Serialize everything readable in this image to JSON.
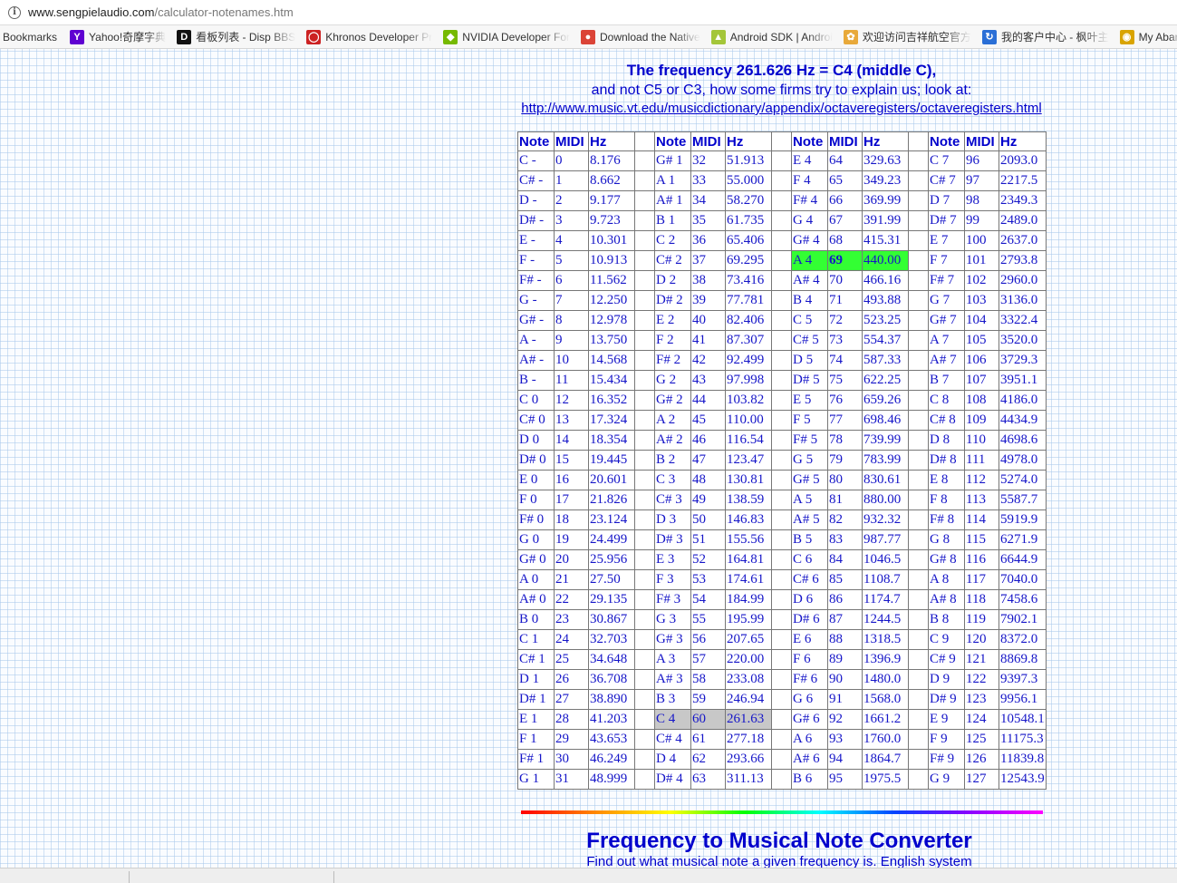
{
  "browser": {
    "url_domain": "www.sengpielaudio.com",
    "url_path": "/calculator-notenames.htm",
    "bookmarks_label": "Bookmarks",
    "bookmarks": [
      {
        "label": "Yahoo!奇摩字典",
        "icon": "yahoo-icon",
        "glyph": "Y",
        "color": "#5f01d1"
      },
      {
        "label": "看板列表 - Disp BBS",
        "icon": "disp-bbs-icon",
        "glyph": "D",
        "color": "#111111"
      },
      {
        "label": "Khronos Developer Pr",
        "icon": "khronos-icon",
        "glyph": "◯",
        "color": "#cc2222"
      },
      {
        "label": "NVIDIA Developer For",
        "icon": "nvidia-icon",
        "glyph": "◆",
        "color": "#76b900"
      },
      {
        "label": "Download the Native",
        "icon": "chrome-icon",
        "glyph": "●",
        "color": "#db4437"
      },
      {
        "label": "Android SDK | Androi",
        "icon": "android-icon",
        "glyph": "▲",
        "color": "#a4c639"
      },
      {
        "label": "欢迎访问吉祥航空官方",
        "icon": "juneyao-icon",
        "glyph": "✿",
        "color": "#e8a93a"
      },
      {
        "label": "我的客户中心 - 枫叶主",
        "icon": "refresh-icon",
        "glyph": "↻",
        "color": "#2b6fd6"
      },
      {
        "label": "My Aban",
        "icon": "aban-icon",
        "glyph": "◉",
        "color": "#d9a400"
      }
    ]
  },
  "page": {
    "headline": "The frequency 261.626 Hz = C4 (middle C),",
    "subline": "and not C5 or C3, how some firms try to explain us; look at:",
    "link": "http://www.music.vt.edu/musicdictionary/appendix/octaveregisters/octaveregisters.html",
    "converter_title": "Frequency to Musical Note Converter",
    "converter_subtitle": "Find out what musical note a given frequency is. English system"
  },
  "note_table": {
    "headers": [
      "Note",
      "MIDI",
      "Hz"
    ],
    "highlight_colors": {
      "a4": "#33ff33",
      "c4": "#c8c8c8"
    },
    "columns": [
      [
        [
          "C -",
          "0",
          "8.176"
        ],
        [
          "C# -",
          "1",
          "8.662"
        ],
        [
          "D -",
          "2",
          "9.177"
        ],
        [
          "D# -",
          "3",
          "9.723"
        ],
        [
          "E -",
          "4",
          "10.301"
        ],
        [
          "F -",
          "5",
          "10.913"
        ],
        [
          "F# -",
          "6",
          "11.562"
        ],
        [
          "G -",
          "7",
          "12.250"
        ],
        [
          "G# -",
          "8",
          "12.978"
        ],
        [
          "A -",
          "9",
          "13.750"
        ],
        [
          "A# -",
          "10",
          "14.568"
        ],
        [
          "B -",
          "11",
          "15.434"
        ],
        [
          "C 0",
          "12",
          "16.352"
        ],
        [
          "C# 0",
          "13",
          "17.324"
        ],
        [
          "D 0",
          "14",
          "18.354"
        ],
        [
          "D# 0",
          "15",
          "19.445"
        ],
        [
          "E 0",
          "16",
          "20.601"
        ],
        [
          "F 0",
          "17",
          "21.826"
        ],
        [
          "F# 0",
          "18",
          "23.124"
        ],
        [
          "G 0",
          "19",
          "24.499"
        ],
        [
          "G# 0",
          "20",
          "25.956"
        ],
        [
          "A 0",
          "21",
          "27.50"
        ],
        [
          "A# 0",
          "22",
          "29.135"
        ],
        [
          "B 0",
          "23",
          "30.867"
        ],
        [
          "C 1",
          "24",
          "32.703"
        ],
        [
          "C# 1",
          "25",
          "34.648"
        ],
        [
          "D 1",
          "26",
          "36.708"
        ],
        [
          "D# 1",
          "27",
          "38.890"
        ],
        [
          "E 1",
          "28",
          "41.203"
        ],
        [
          "F 1",
          "29",
          "43.653"
        ],
        [
          "F# 1",
          "30",
          "46.249"
        ],
        [
          "G 1",
          "31",
          "48.999"
        ]
      ],
      [
        [
          "G# 1",
          "32",
          "51.913"
        ],
        [
          "A 1",
          "33",
          "55.000"
        ],
        [
          "A# 1",
          "34",
          "58.270"
        ],
        [
          "B 1",
          "35",
          "61.735"
        ],
        [
          "C 2",
          "36",
          "65.406"
        ],
        [
          "C# 2",
          "37",
          "69.295"
        ],
        [
          "D 2",
          "38",
          "73.416"
        ],
        [
          "D# 2",
          "39",
          "77.781"
        ],
        [
          "E 2",
          "40",
          "82.406"
        ],
        [
          "F 2",
          "41",
          "87.307"
        ],
        [
          "F# 2",
          "42",
          "92.499"
        ],
        [
          "G 2",
          "43",
          "97.998"
        ],
        [
          "G# 2",
          "44",
          "103.82"
        ],
        [
          "A 2",
          "45",
          "110.00"
        ],
        [
          "A# 2",
          "46",
          "116.54"
        ],
        [
          "B 2",
          "47",
          "123.47"
        ],
        [
          "C 3",
          "48",
          "130.81"
        ],
        [
          "C# 3",
          "49",
          "138.59"
        ],
        [
          "D 3",
          "50",
          "146.83"
        ],
        [
          "D# 3",
          "51",
          "155.56"
        ],
        [
          "E 3",
          "52",
          "164.81"
        ],
        [
          "F 3",
          "53",
          "174.61"
        ],
        [
          "F# 3",
          "54",
          "184.99"
        ],
        [
          "G 3",
          "55",
          "195.99"
        ],
        [
          "G# 3",
          "56",
          "207.65"
        ],
        [
          "A 3",
          "57",
          "220.00"
        ],
        [
          "A# 3",
          "58",
          "233.08"
        ],
        [
          "B 3",
          "59",
          "246.94"
        ],
        [
          "C 4",
          "60",
          "261.63"
        ],
        [
          "C# 4",
          "61",
          "277.18"
        ],
        [
          "D 4",
          "62",
          "293.66"
        ],
        [
          "D# 4",
          "63",
          "311.13"
        ]
      ],
      [
        [
          "E 4",
          "64",
          "329.63"
        ],
        [
          "F 4",
          "65",
          "349.23"
        ],
        [
          "F# 4",
          "66",
          "369.99"
        ],
        [
          "G 4",
          "67",
          "391.99"
        ],
        [
          "G# 4",
          "68",
          "415.31"
        ],
        [
          "A 4",
          "69",
          "440.00"
        ],
        [
          "A# 4",
          "70",
          "466.16"
        ],
        [
          "B 4",
          "71",
          "493.88"
        ],
        [
          "C 5",
          "72",
          "523.25"
        ],
        [
          "C# 5",
          "73",
          "554.37"
        ],
        [
          "D 5",
          "74",
          "587.33"
        ],
        [
          "D# 5",
          "75",
          "622.25"
        ],
        [
          "E 5",
          "76",
          "659.26"
        ],
        [
          "F 5",
          "77",
          "698.46"
        ],
        [
          "F# 5",
          "78",
          "739.99"
        ],
        [
          "G 5",
          "79",
          "783.99"
        ],
        [
          "G# 5",
          "80",
          "830.61"
        ],
        [
          "A 5",
          "81",
          "880.00"
        ],
        [
          "A# 5",
          "82",
          "932.32"
        ],
        [
          "B 5",
          "83",
          "987.77"
        ],
        [
          "C 6",
          "84",
          "1046.5"
        ],
        [
          "C# 6",
          "85",
          "1108.7"
        ],
        [
          "D 6",
          "86",
          "1174.7"
        ],
        [
          "D# 6",
          "87",
          "1244.5"
        ],
        [
          "E 6",
          "88",
          "1318.5"
        ],
        [
          "F 6",
          "89",
          "1396.9"
        ],
        [
          "F# 6",
          "90",
          "1480.0"
        ],
        [
          "G 6",
          "91",
          "1568.0"
        ],
        [
          "G# 6",
          "92",
          "1661.2"
        ],
        [
          "A 6",
          "93",
          "1760.0"
        ],
        [
          "A# 6",
          "94",
          "1864.7"
        ],
        [
          "B 6",
          "95",
          "1975.5"
        ]
      ],
      [
        [
          "C 7",
          "96",
          "2093.0"
        ],
        [
          "C# 7",
          "97",
          "2217.5"
        ],
        [
          "D 7",
          "98",
          "2349.3"
        ],
        [
          "D# 7",
          "99",
          "2489.0"
        ],
        [
          "E 7",
          "100",
          "2637.0"
        ],
        [
          "F 7",
          "101",
          "2793.8"
        ],
        [
          "F# 7",
          "102",
          "2960.0"
        ],
        [
          "G 7",
          "103",
          "3136.0"
        ],
        [
          "G# 7",
          "104",
          "3322.4"
        ],
        [
          "A 7",
          "105",
          "3520.0"
        ],
        [
          "A# 7",
          "106",
          "3729.3"
        ],
        [
          "B 7",
          "107",
          "3951.1"
        ],
        [
          "C 8",
          "108",
          "4186.0"
        ],
        [
          "C# 8",
          "109",
          "4434.9"
        ],
        [
          "D 8",
          "110",
          "4698.6"
        ],
        [
          "D# 8",
          "111",
          "4978.0"
        ],
        [
          "E 8",
          "112",
          "5274.0"
        ],
        [
          "F 8",
          "113",
          "5587.7"
        ],
        [
          "F# 8",
          "114",
          "5919.9"
        ],
        [
          "G 8",
          "115",
          "6271.9"
        ],
        [
          "G# 8",
          "116",
          "6644.9"
        ],
        [
          "A 8",
          "117",
          "7040.0"
        ],
        [
          "A# 8",
          "118",
          "7458.6"
        ],
        [
          "B 8",
          "119",
          "7902.1"
        ],
        [
          "C 9",
          "120",
          "8372.0"
        ],
        [
          "C# 9",
          "121",
          "8869.8"
        ],
        [
          "D 9",
          "122",
          "9397.3"
        ],
        [
          "D# 9",
          "123",
          "9956.1"
        ],
        [
          "E 9",
          "124",
          "10548.1"
        ],
        [
          "F 9",
          "125",
          "11175.3"
        ],
        [
          "F# 9",
          "126",
          "11839.8"
        ],
        [
          "G 9",
          "127",
          "12543.9"
        ]
      ]
    ]
  }
}
